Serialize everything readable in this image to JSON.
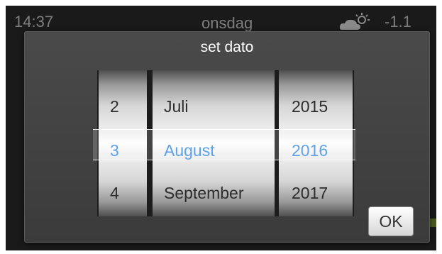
{
  "statusbar": {
    "time": "14:37",
    "day": "onsdag",
    "weather_icon": "partly-cloudy-icon",
    "temperature": "-1.1"
  },
  "dialog": {
    "title": "set dato",
    "ok_label": "OK"
  },
  "picker": {
    "days": [
      "2",
      "3",
      "4"
    ],
    "months": [
      "Juli",
      "August",
      "September"
    ],
    "years": [
      "2015",
      "2016",
      "2017"
    ],
    "selected": {
      "day": "3",
      "month": "August",
      "year": "2016"
    }
  },
  "colors": {
    "selected_text": "#3a8ee6",
    "dialog_bg": "#444444",
    "background_accent": "#6f8f24"
  }
}
